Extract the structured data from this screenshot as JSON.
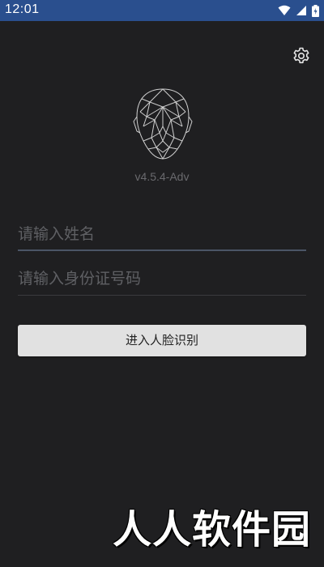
{
  "status_bar": {
    "time": "12:01",
    "icons": [
      "wifi-icon",
      "signal-icon",
      "battery-icon"
    ],
    "background_color": "#2a4f8e"
  },
  "header": {
    "settings_icon": "gear-icon"
  },
  "logo": {
    "icon": "face-wireframe-icon",
    "version": "v4.5.4-Adv"
  },
  "form": {
    "name_placeholder": "请输入姓名",
    "name_value": "",
    "id_placeholder": "请输入身份证号码",
    "id_value": "",
    "submit_label": "进入人脸识别"
  },
  "watermark": {
    "text": "人人软件园"
  },
  "colors": {
    "background": "#1f1f21",
    "button": "#e1e1e1",
    "placeholder": "#5f6064"
  }
}
